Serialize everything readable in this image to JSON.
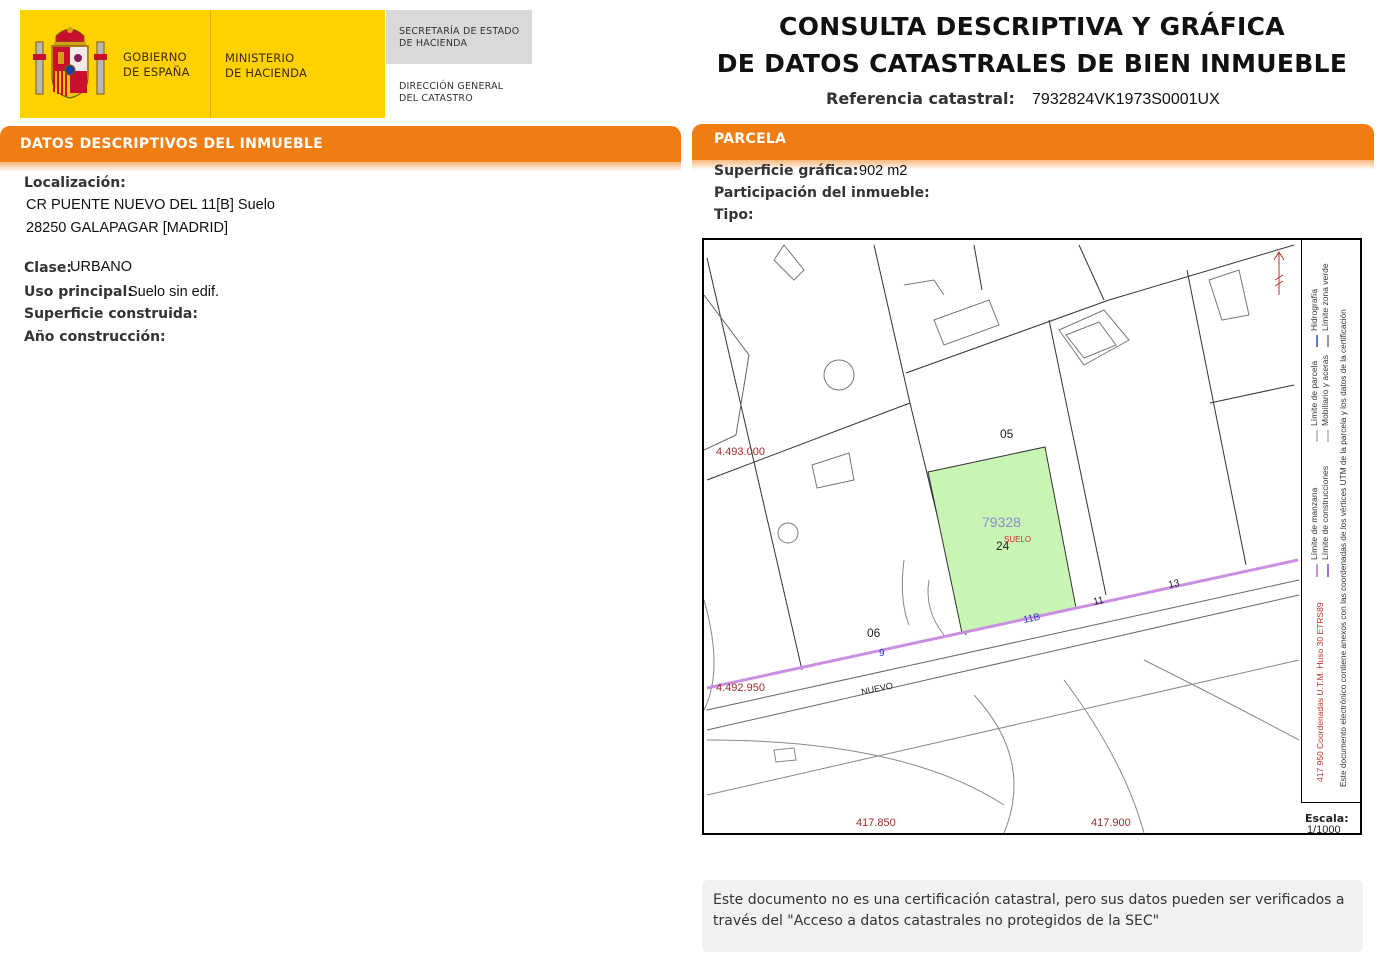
{
  "header": {
    "gov_line1": "GOBIERNO",
    "gov_line2": "DE ESPAÑA",
    "ministry_line1": "MINISTERIO",
    "ministry_line2": "DE HACIENDA",
    "secretaria_line1": "SECRETARÍA DE ESTADO",
    "secretaria_line2": "DE HACIENDA",
    "direccion_line1": "DIRECCIÓN GENERAL",
    "direccion_line2": "DEL CATASTRO",
    "title_line1": "CONSULTA DESCRIPTIVA Y GRÁFICA",
    "title_line2": "DE DATOS CATASTRALES DE BIEN INMUEBLE",
    "ref_label": "Referencia catastral:",
    "ref_value": "7932824VK1973S0001UX"
  },
  "left_section": {
    "title": "DATOS DESCRIPTIVOS DEL INMUEBLE",
    "localizacion_label": "Localización:",
    "localizacion_line1": "CR PUENTE NUEVO DEL 11[B] Suelo",
    "localizacion_line2": "28250 GALAPAGAR [MADRID]",
    "clase_label": "Clase:",
    "clase_value": "URBANO",
    "uso_label": "Uso principal:",
    "uso_value": "Suelo sin edif.",
    "superficie_label": "Superficie construida:",
    "anio_label": "Año construcción:"
  },
  "right_section": {
    "title": "PARCELA",
    "superficie_label": "Superficie gráfica:",
    "superficie_value": "902 m2",
    "participacion_label": "Participación del inmueble:",
    "tipo_label": "Tipo:"
  },
  "map": {
    "parcel_number": "79328",
    "parcel_sub": "24",
    "parcel_use": "SUELO",
    "label_05": "05",
    "label_06": "06",
    "num_9": "9",
    "num_11b": "11B",
    "num_11": "11",
    "num_13": "13",
    "street": "NUEVO",
    "coord_y_top": "4.493.000",
    "coord_y_bottom": "4.492.950",
    "coord_x_left": "417.850",
    "coord_x_right": "417.900",
    "scale_label": "Escala:",
    "scale_value": "1/1000",
    "legend_utm": "417 950 Coordenadas U.T.M. Huso 30 ETRS89",
    "legend_manzana": "Límite de manzana",
    "legend_parcela": "Límite de parcela",
    "legend_hidrografia": "Hidrografía",
    "legend_construcciones": "Límite de construcciones",
    "legend_mobiliario": "Mobiliario y aceras",
    "legend_zona_verde": "Límite zona verde",
    "legend_note": "Este documento electrónico contiene anexos con las coordenadas de los vértices UTM de la parcela y los datos de la certificación",
    "colors": {
      "parcel_fill": "#c9f5b4",
      "manzana_line": "#c98fe0",
      "coord_text": "#a02a2a",
      "parcel_number_text": "#8a8ad0",
      "utm_legend_text": "#c0302a"
    }
  },
  "footer": {
    "line1": "Este documento no es una certificación catastral, pero sus datos pueden ser verificados a",
    "line2": "través del \"Acceso a datos catastrales no protegidos de la SEC\""
  },
  "colors": {
    "accent_orange": "#f07d12",
    "logo_yellow": "#ffd100"
  }
}
